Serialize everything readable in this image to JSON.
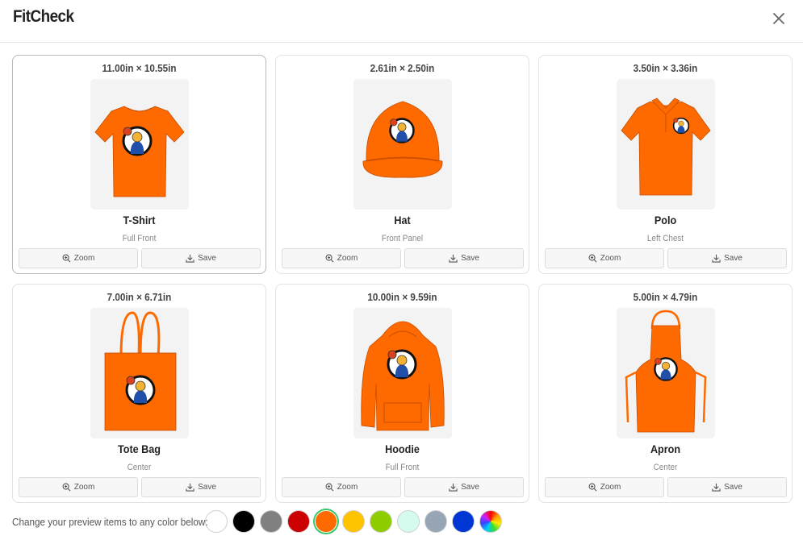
{
  "app": {
    "title": "FitCheck"
  },
  "products": [
    {
      "dims": "11.00in × 10.55in",
      "name": "T-Shirt",
      "placement": "Full Front",
      "icon": "tshirt-icon"
    },
    {
      "dims": "2.61in × 2.50in",
      "name": "Hat",
      "placement": "Front Panel",
      "icon": "hat-icon"
    },
    {
      "dims": "3.50in × 3.36in",
      "name": "Polo",
      "placement": "Left Chest",
      "icon": "polo-icon"
    },
    {
      "dims": "7.00in × 6.71in",
      "name": "Tote Bag",
      "placement": "Center",
      "icon": "tote-bag-icon"
    },
    {
      "dims": "10.00in × 9.59in",
      "name": "Hoodie",
      "placement": "Full Front",
      "icon": "hoodie-icon"
    },
    {
      "dims": "5.00in × 4.79in",
      "name": "Apron",
      "placement": "Center",
      "icon": "apron-icon"
    }
  ],
  "buttons": {
    "zoom": "Zoom",
    "save": "Save"
  },
  "colors": {
    "label": "Change your preview items to any color below:",
    "swatches": [
      "#ffffff",
      "#000000",
      "#808080",
      "#cc0000",
      "#ff6a00",
      "#ffc400",
      "#8fcc00",
      "#d4fbee",
      "#97a6b5",
      "#0037d4",
      "rainbow"
    ],
    "selected": "#ff6a00"
  }
}
